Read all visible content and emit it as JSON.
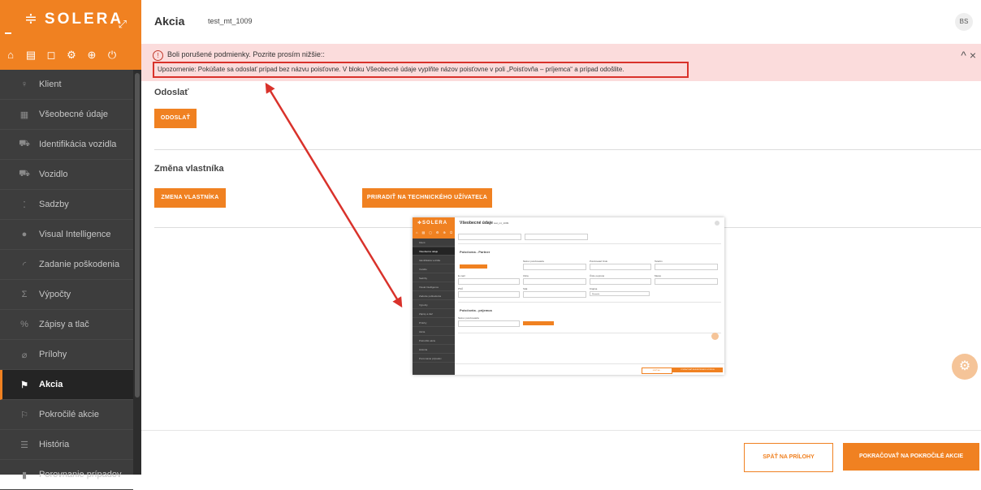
{
  "brand": {
    "logo_text": "SOLERA",
    "logo_mark": "≑",
    "expand_glyph": "⤢"
  },
  "toolbar_icons": [
    "home-icon",
    "document-icon",
    "copy-icon",
    "settings-icon",
    "globe-icon",
    "power-icon"
  ],
  "toolbar_glyphs": [
    "⌂",
    "▤",
    "◻",
    "⚙",
    "⊕",
    "⏻"
  ],
  "menu": [
    {
      "label": "Klient",
      "glyph": "♀",
      "icon": "person-icon"
    },
    {
      "label": "Všeobecné údaje",
      "glyph": "▦",
      "icon": "car-info-icon"
    },
    {
      "label": "Identifikácia vozidla",
      "glyph": "⛟",
      "icon": "car-id-icon"
    },
    {
      "label": "Vozidlo",
      "glyph": "⛟",
      "icon": "car-icon"
    },
    {
      "label": "Sadzby",
      "glyph": "⁚",
      "icon": "rates-icon"
    },
    {
      "label": "Visual Intelligence",
      "glyph": "●",
      "icon": "visual-intelligence-icon"
    },
    {
      "label": "Zadanie poškodenia",
      "glyph": "◜",
      "icon": "damage-icon"
    },
    {
      "label": "Výpočty",
      "glyph": "Σ",
      "icon": "sigma-icon"
    },
    {
      "label": "Zápisy a tlač",
      "glyph": "%",
      "icon": "percent-icon"
    },
    {
      "label": "Prílohy",
      "glyph": "⌀",
      "icon": "paperclip-icon"
    },
    {
      "label": "Akcia",
      "glyph": "⚑",
      "icon": "action-icon",
      "active": true
    },
    {
      "label": "Pokročilé akcie",
      "glyph": "⚐",
      "icon": "advanced-action-icon"
    },
    {
      "label": "História",
      "glyph": "☰",
      "icon": "history-icon"
    },
    {
      "label": "Porovnanie prípadov",
      "glyph": "▮",
      "icon": "compare-icon"
    }
  ],
  "header": {
    "title": "Akcia",
    "case_id": "test_mt_1009",
    "avatar": "BS"
  },
  "alert": {
    "icon_glyph": "!",
    "line1": "Boli porušené podmienky. Pozrite prosím nižšie::",
    "line2": "Upozornenie: Pokúšate sa odoslať prípad bez názvu poisťovne. V bloku Všeobecné údaje vyplňte názov poisťovne v poli „Poisťovňa – príjemca“ a prípad odošlite.",
    "collapse_glyph": "^",
    "close_glyph": "×"
  },
  "sections": {
    "send_title": "Odoslať",
    "send_button": "ODOSLAŤ",
    "owner_title": "Změna vlastníka",
    "owner_button": "ZMENA VLASTNÍKA",
    "assign_button": "PRIRADIŤ NA TECHNICKÉHO UŽÍVATEĽA"
  },
  "footer": {
    "back_button": "SPÄŤ NA PRÍLOHY",
    "next_button": "POKRAČOVAŤ NA POKROČILÉ AKCIE"
  },
  "gear_glyph": "⚙",
  "thumbnail": {
    "logo": "≑SOLERA",
    "icon_row": "⌂ ▤ ◻ ⚙ ⊕ ⏻",
    "title": "Všeobecné údaje",
    "case_id": "test_mt_1009",
    "menu": [
      "Klient",
      "Všeobecné údaje",
      "Identifikácia vozidla",
      "Vozidlo",
      "Sadzby",
      "Visual Intelligence",
      "Zadanie poškodenia",
      "Výpočty",
      "Zápisy a tlač",
      "Prílohy",
      "Akcia",
      "Pokročilé akcie",
      "História",
      "Porovnanie prípadov"
    ],
    "section1": "Poisťovna - Partner",
    "section2": "Poisťovňa - príjemca",
    "labels": [
      "Názov poisťovateľa",
      "Poisťovateľ číslo",
      "Telefón",
      "E-mail",
      "Ulica",
      "Číslo popisné",
      "Mesto",
      "PSČ",
      "Stát",
      "Krajina",
      "Názov poisťovateľa"
    ],
    "select_value": "Slovensko",
    "footer_left": "SPÄŤ NA ...",
    "footer_right": "POKRAČOVAŤ NA IDENTIFIKÁCIU VOZIDLA"
  }
}
